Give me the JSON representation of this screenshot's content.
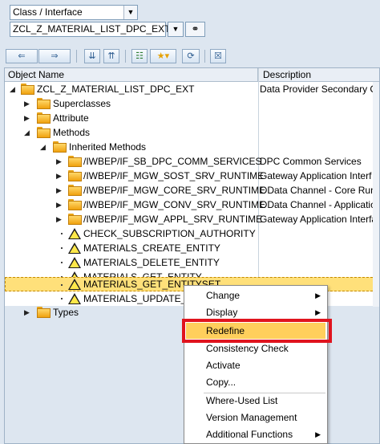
{
  "selector": {
    "type_value": "Class / Interface",
    "object_value": "ZCL_Z_MATERIAL_LIST_DPC_EXT"
  },
  "toolbar": {
    "buttons": [
      "back-icon",
      "forward-icon",
      "expand-icon",
      "collapse-icon",
      "hierarchy-icon",
      "favorite-icon",
      "refresh-icon",
      "close-icon"
    ]
  },
  "tree": {
    "header": {
      "col1": "Object Name",
      "col2": "Description"
    },
    "rows": [
      {
        "label": "ZCL_Z_MATERIAL_LIST_DPC_EXT",
        "desc": "Data Provider Secondary C"
      },
      {
        "label": "Superclasses",
        "desc": ""
      },
      {
        "label": "Attribute",
        "desc": ""
      },
      {
        "label": "Methods",
        "desc": ""
      },
      {
        "label": "Inherited Methods",
        "desc": ""
      },
      {
        "label": "/IWBEP/IF_SB_DPC_COMM_SERVICES",
        "desc": "DPC Common Services"
      },
      {
        "label": "/IWBEP/IF_MGW_SOST_SRV_RUNTIME",
        "desc": "Gateway Application Interf"
      },
      {
        "label": "/IWBEP/IF_MGW_CORE_SRV_RUNTIME",
        "desc": "OData Channel - Core Runt"
      },
      {
        "label": "/IWBEP/IF_MGW_CONV_SRV_RUNTIME",
        "desc": "OData Channel - Applicatio"
      },
      {
        "label": "/IWBEP/IF_MGW_APPL_SRV_RUNTIME",
        "desc": "Gateway Application Interfa"
      },
      {
        "label": "CHECK_SUBSCRIPTION_AUTHORITY",
        "desc": ""
      },
      {
        "label": "MATERIALS_CREATE_ENTITY",
        "desc": ""
      },
      {
        "label": "MATERIALS_DELETE_ENTITY",
        "desc": ""
      },
      {
        "label": "MATERIALS_GET_ENTITY",
        "desc": ""
      },
      {
        "label": "MATERIALS_GET_ENTITYSET",
        "desc": ""
      },
      {
        "label": "MATERIALS_UPDATE_E",
        "desc": ""
      },
      {
        "label": "Types",
        "desc": ""
      }
    ]
  },
  "context_menu": {
    "items": [
      {
        "label": "Change",
        "submenu": true
      },
      {
        "label": "Display",
        "submenu": true
      },
      {
        "label": "Redefine",
        "submenu": false
      },
      {
        "label": "Consistency Check",
        "submenu": false
      },
      {
        "label": "Activate",
        "submenu": false
      },
      {
        "label": "Copy...",
        "submenu": false
      },
      {
        "label": "Where-Used List",
        "submenu": false
      },
      {
        "label": "Version Management",
        "submenu": false
      },
      {
        "label": "Additional Functions",
        "submenu": true
      }
    ]
  },
  "colors": {
    "highlight_border": "#e0141e",
    "menu_hover": "#ffcf5c",
    "selection": "#ffe07a"
  }
}
